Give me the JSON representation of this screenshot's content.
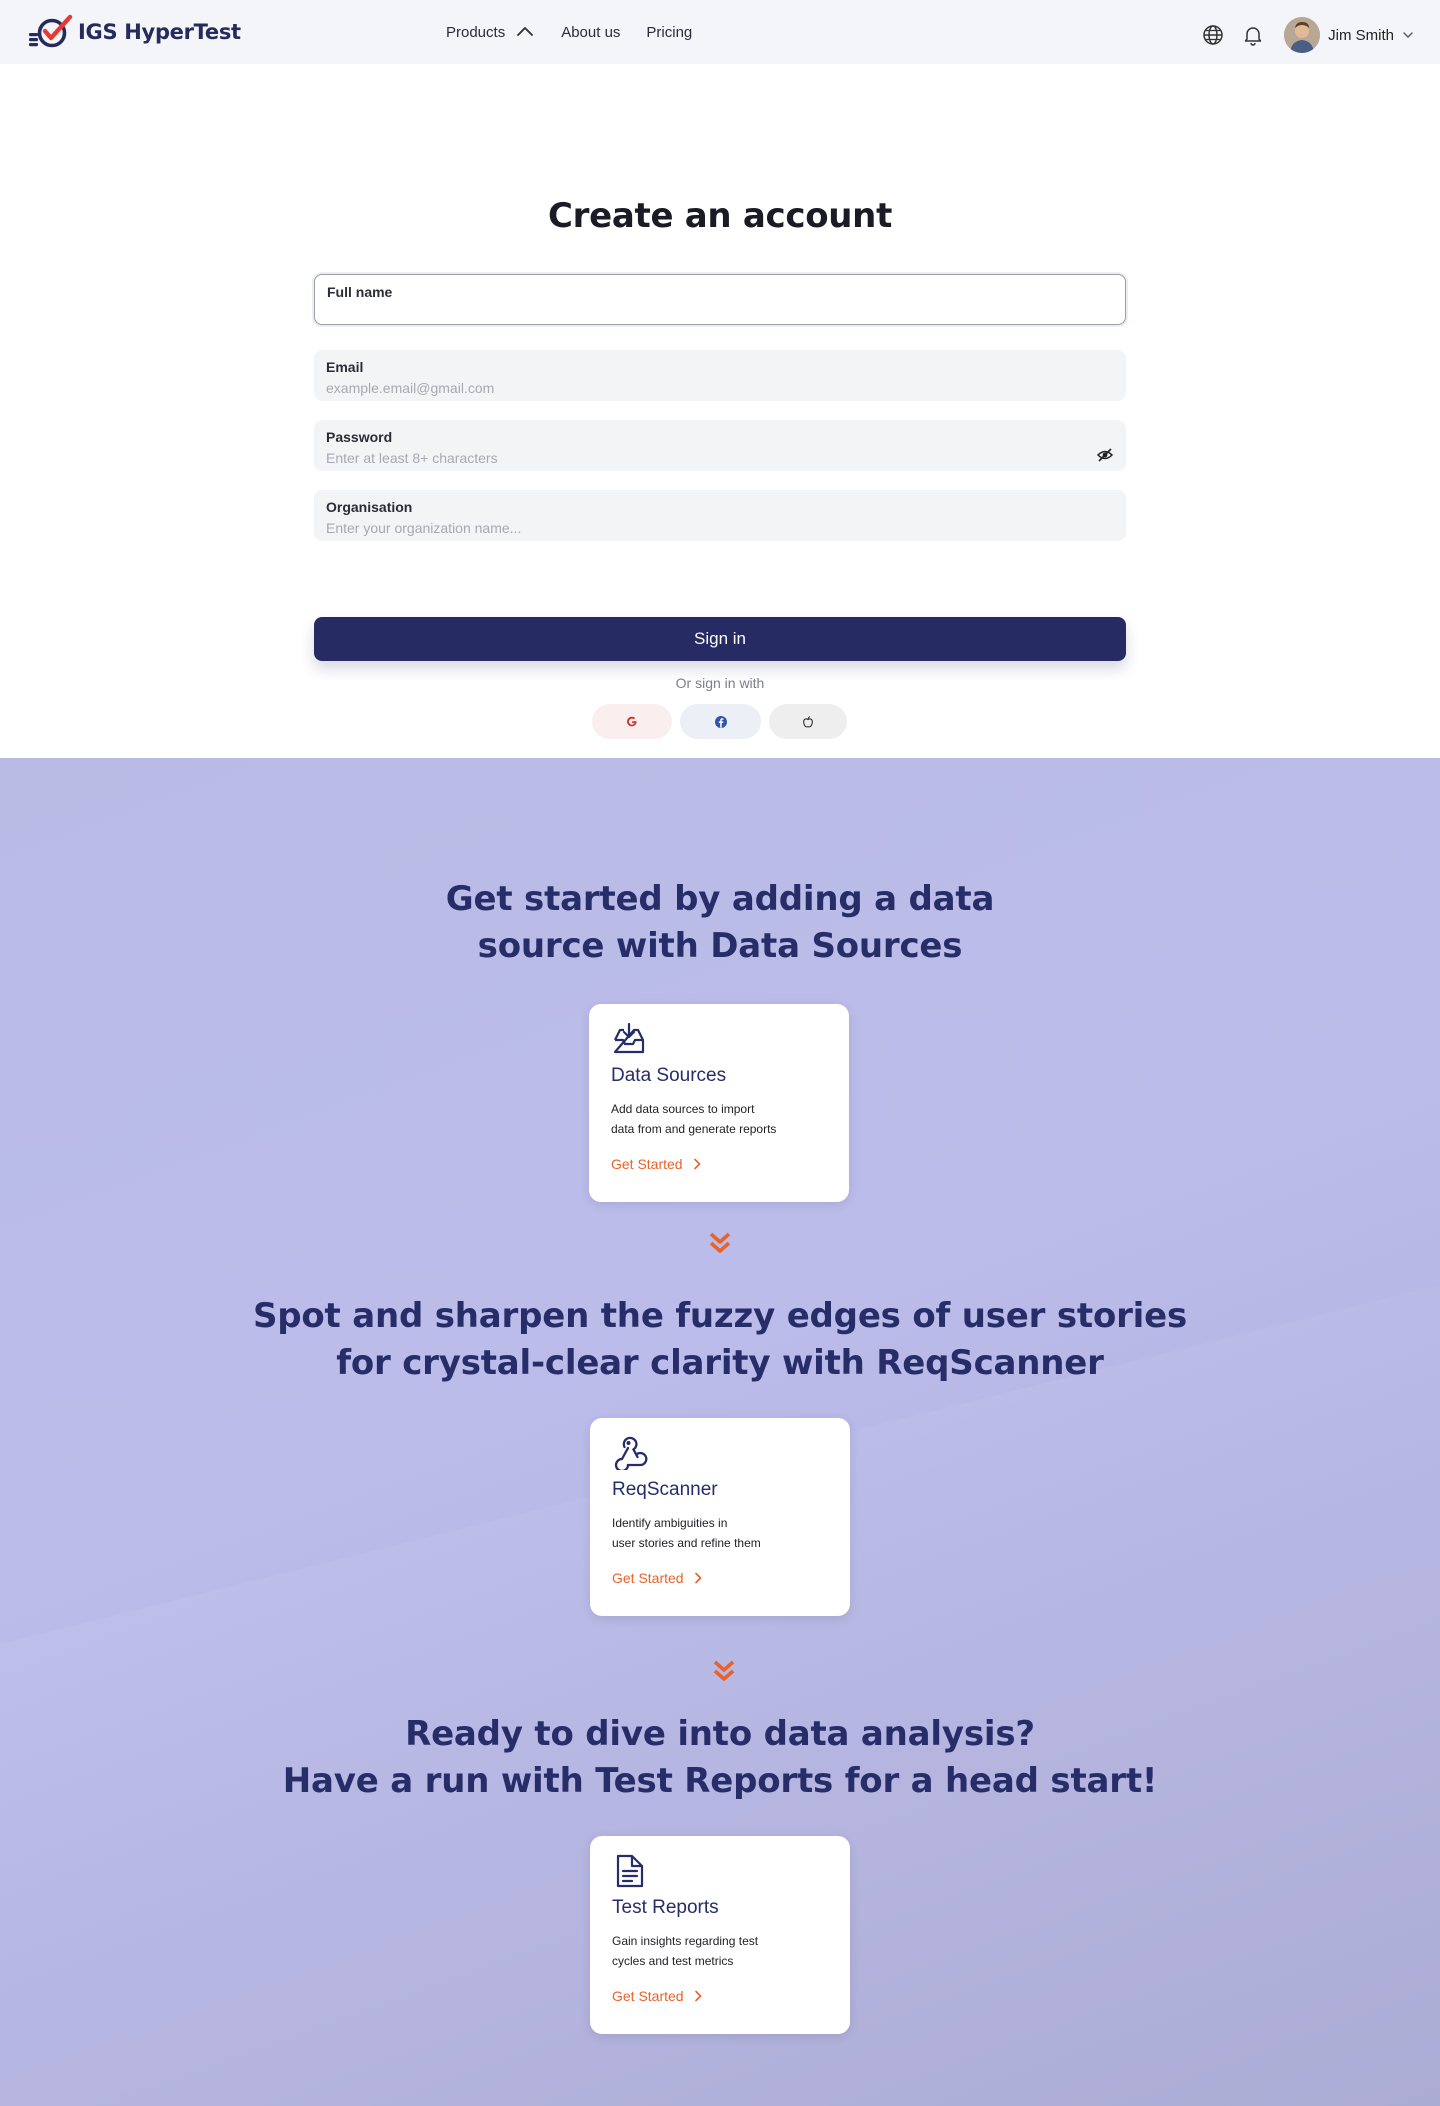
{
  "header": {
    "logo_text": "IGS HyperTest",
    "nav": [
      {
        "label": "Products"
      },
      {
        "label": "About us"
      },
      {
        "label": "Pricing"
      }
    ],
    "user_name": "Jim Smith"
  },
  "form": {
    "title": "Create an account",
    "fields": {
      "full_name": {
        "label": "Full name",
        "value": "",
        "placeholder": ""
      },
      "email": {
        "label": "Email",
        "placeholder": "example.email@gmail.com"
      },
      "password": {
        "label": "Password",
        "placeholder": "Enter at least 8+ characters"
      },
      "organisation": {
        "label": "Organisation",
        "placeholder": "Enter your organization name..."
      }
    },
    "submit_label": "Sign in",
    "alt_text": "Or sign in with",
    "social": [
      "google-icon",
      "facebook-icon",
      "apple-icon"
    ]
  },
  "sections": [
    {
      "heading_line1": "Get started by adding a data",
      "heading_line2": "source with Data Sources",
      "card": {
        "icon": "inbox-download-icon",
        "title": "Data Sources",
        "desc_line1": "Add data sources to import",
        "desc_line2": "data from and generate reports",
        "cta": "Get Started"
      }
    },
    {
      "heading_line1": "Spot and sharpen the fuzzy edges of user stories",
      "heading_line2": "for crystal-clear clarity with ReqScanner",
      "card": {
        "icon": "webhook-icon",
        "title": "ReqScanner",
        "desc_line1": "Identify ambiguities in",
        "desc_line2": "user stories and refine them",
        "cta": "Get Started"
      }
    },
    {
      "heading_line1": "Ready to dive into data analysis?",
      "heading_line2": "Have a run with Test Reports for a head start!",
      "card": {
        "icon": "document-icon",
        "title": "Test Reports",
        "desc_line1": "Gain insights regarding test",
        "desc_line2": "cycles and test metrics",
        "cta": "Get Started"
      }
    }
  ],
  "colors": {
    "brand_navy": "#262c63",
    "accent_orange": "#e8632a",
    "logo_red": "#e53935",
    "lower_bg": "#b9bbe5"
  }
}
